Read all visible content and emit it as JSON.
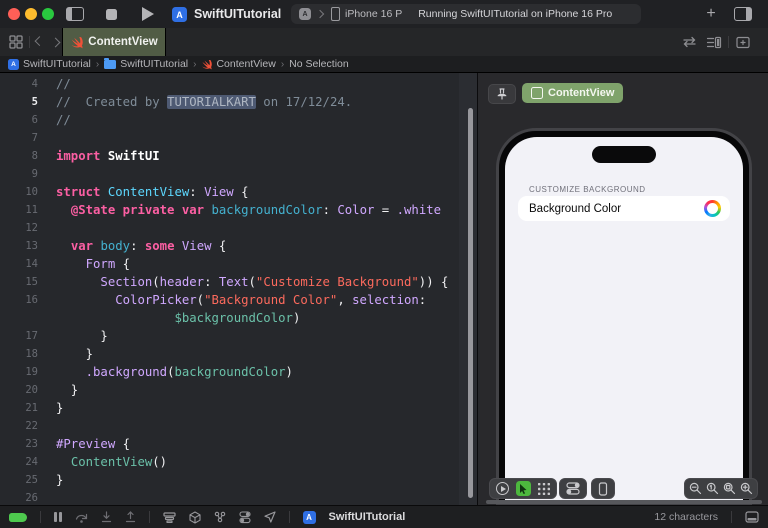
{
  "titlebar": {
    "title": "SwiftUITutorial",
    "destination": "iPhone 16 P",
    "status": "Running SwiftUITutorial on iPhone 16 Pro",
    "add_button_label": "+",
    "app_initial": "A"
  },
  "tabbar": {
    "tab": {
      "label": "ContentView"
    }
  },
  "jumpbar": {
    "separator": "›",
    "items": [
      {
        "label": "SwiftUITutorial",
        "icon": "app-icon"
      },
      {
        "label": "SwiftUITutorial",
        "icon": "folder-icon"
      },
      {
        "label": "ContentView",
        "icon": "swift-icon"
      },
      {
        "label": "No Selection",
        "icon": null
      }
    ]
  },
  "editor": {
    "language": "swift",
    "current_line": "5",
    "lines": [
      {
        "n": "4",
        "tokens": [
          [
            "com",
            "//"
          ]
        ]
      },
      {
        "n": "5",
        "cur": true,
        "tokens": [
          [
            "com",
            "//  Created by "
          ],
          [
            "sel",
            "TUTORIALKART"
          ],
          [
            "com",
            " on 17/12/24."
          ]
        ]
      },
      {
        "n": "6",
        "tokens": [
          [
            "com",
            "//"
          ]
        ]
      },
      {
        "n": "7",
        "tokens": []
      },
      {
        "n": "8",
        "tokens": [
          [
            "kw",
            "import"
          ],
          [
            "plain",
            " "
          ],
          [
            "plainb",
            "SwiftUI"
          ]
        ]
      },
      {
        "n": "9",
        "tokens": []
      },
      {
        "n": "10",
        "tokens": [
          [
            "kw",
            "struct"
          ],
          [
            "plain",
            " "
          ],
          [
            "type",
            "ContentView"
          ],
          [
            "plain",
            ": "
          ],
          [
            "fw",
            "View"
          ],
          [
            "plain",
            " {"
          ]
        ]
      },
      {
        "n": "11",
        "tokens": [
          [
            "plain",
            "  "
          ],
          [
            "kw",
            "@State"
          ],
          [
            "plain",
            " "
          ],
          [
            "kw",
            "private"
          ],
          [
            "plain",
            " "
          ],
          [
            "kw",
            "var"
          ],
          [
            "plain",
            " "
          ],
          [
            "decl",
            "backgroundColor"
          ],
          [
            "plain",
            ": "
          ],
          [
            "fw",
            "Color"
          ],
          [
            "plain",
            " = "
          ],
          [
            "fw",
            ".white"
          ]
        ]
      },
      {
        "n": "12",
        "tokens": []
      },
      {
        "n": "13",
        "tokens": [
          [
            "plain",
            "  "
          ],
          [
            "kw",
            "var"
          ],
          [
            "plain",
            " "
          ],
          [
            "decl",
            "body"
          ],
          [
            "plain",
            ": "
          ],
          [
            "kw",
            "some"
          ],
          [
            "plain",
            " "
          ],
          [
            "fw",
            "View"
          ],
          [
            "plain",
            " {"
          ]
        ]
      },
      {
        "n": "14",
        "tokens": [
          [
            "plain",
            "    "
          ],
          [
            "fw",
            "Form"
          ],
          [
            "plain",
            " {"
          ]
        ]
      },
      {
        "n": "15",
        "tokens": [
          [
            "plain",
            "      "
          ],
          [
            "fw",
            "Section"
          ],
          [
            "plain",
            "("
          ],
          [
            "fw",
            "header"
          ],
          [
            "plain",
            ": "
          ],
          [
            "fw",
            "Text"
          ],
          [
            "plain",
            "("
          ],
          [
            "str",
            "\"Customize Background\""
          ],
          [
            "plain",
            ")) {"
          ]
        ]
      },
      {
        "n": "16",
        "tokens": [
          [
            "plain",
            "        "
          ],
          [
            "fw",
            "ColorPicker"
          ],
          [
            "plain",
            "("
          ],
          [
            "str",
            "\"Background Color\""
          ],
          [
            "plain",
            ", "
          ],
          [
            "fw",
            "selection"
          ],
          [
            "plain",
            ":"
          ]
        ]
      },
      {
        "n": "",
        "tokens": [
          [
            "plain",
            "                "
          ],
          [
            "use",
            "$backgroundColor"
          ],
          [
            "plain",
            ")"
          ]
        ]
      },
      {
        "n": "17",
        "tokens": [
          [
            "plain",
            "      }"
          ]
        ]
      },
      {
        "n": "18",
        "tokens": [
          [
            "plain",
            "    }"
          ]
        ]
      },
      {
        "n": "19",
        "tokens": [
          [
            "plain",
            "    "
          ],
          [
            "fw",
            ".background"
          ],
          [
            "plain",
            "("
          ],
          [
            "use",
            "backgroundColor"
          ],
          [
            "plain",
            ")"
          ]
        ]
      },
      {
        "n": "20",
        "tokens": [
          [
            "plain",
            "  }"
          ]
        ]
      },
      {
        "n": "21",
        "tokens": [
          [
            "plain",
            "}"
          ]
        ]
      },
      {
        "n": "22",
        "tokens": []
      },
      {
        "n": "23",
        "tokens": [
          [
            "fw",
            "#Preview"
          ],
          [
            "plain",
            " {"
          ]
        ]
      },
      {
        "n": "24",
        "tokens": [
          [
            "plain",
            "  "
          ],
          [
            "use",
            "ContentView"
          ],
          [
            "plain",
            "()"
          ]
        ]
      },
      {
        "n": "25",
        "tokens": [
          [
            "plain",
            "}"
          ]
        ]
      },
      {
        "n": "26",
        "tokens": []
      }
    ]
  },
  "preview": {
    "badge_label": "ContentView",
    "device": {
      "section_header": "CUSTOMIZE BACKGROUND",
      "row_label": "Background Color"
    },
    "toolbar_icons": [
      "live-mode-icon",
      "select-mode-icon",
      "variants-icon",
      "environment-overrides-icon",
      "preview-device-icon",
      "zoom-out-icon",
      "zoom-100-icon",
      "zoom-fit-icon",
      "zoom-in-icon"
    ]
  },
  "statusbar": {
    "process": "SwiftUITutorial",
    "right_status": "12 characters",
    "icons": [
      "breakpoints-toggle",
      "pause-icon",
      "step-over-icon",
      "step-into-icon",
      "step-out-icon",
      "view-hierarchy-icon",
      "memory-graph-icon",
      "debug-graph-icon",
      "environment-overrides-icon",
      "simulate-location-icon",
      "bottom-panel-icon"
    ]
  },
  "colors": {
    "c-com": "#7f8c98",
    "c-kw": "#fc5fa3",
    "c-str": "#fc6a5d",
    "c-type": "#5dd8ff",
    "c-decl": "#44b1cf",
    "c-fw": "#d0a8ff",
    "c-use": "#6bc1a9",
    "c-sel": "#4e5a73",
    "tab-green": "#515c45",
    "badge-green": "#7fa36b",
    "swift-orange": "#f05138",
    "run-green": "#4db83e",
    "breakpoint-green": "#4ec94e",
    "traffic-red": "#ff5f57",
    "traffic-yellow": "#febc2e",
    "traffic-green": "#29c83f"
  }
}
